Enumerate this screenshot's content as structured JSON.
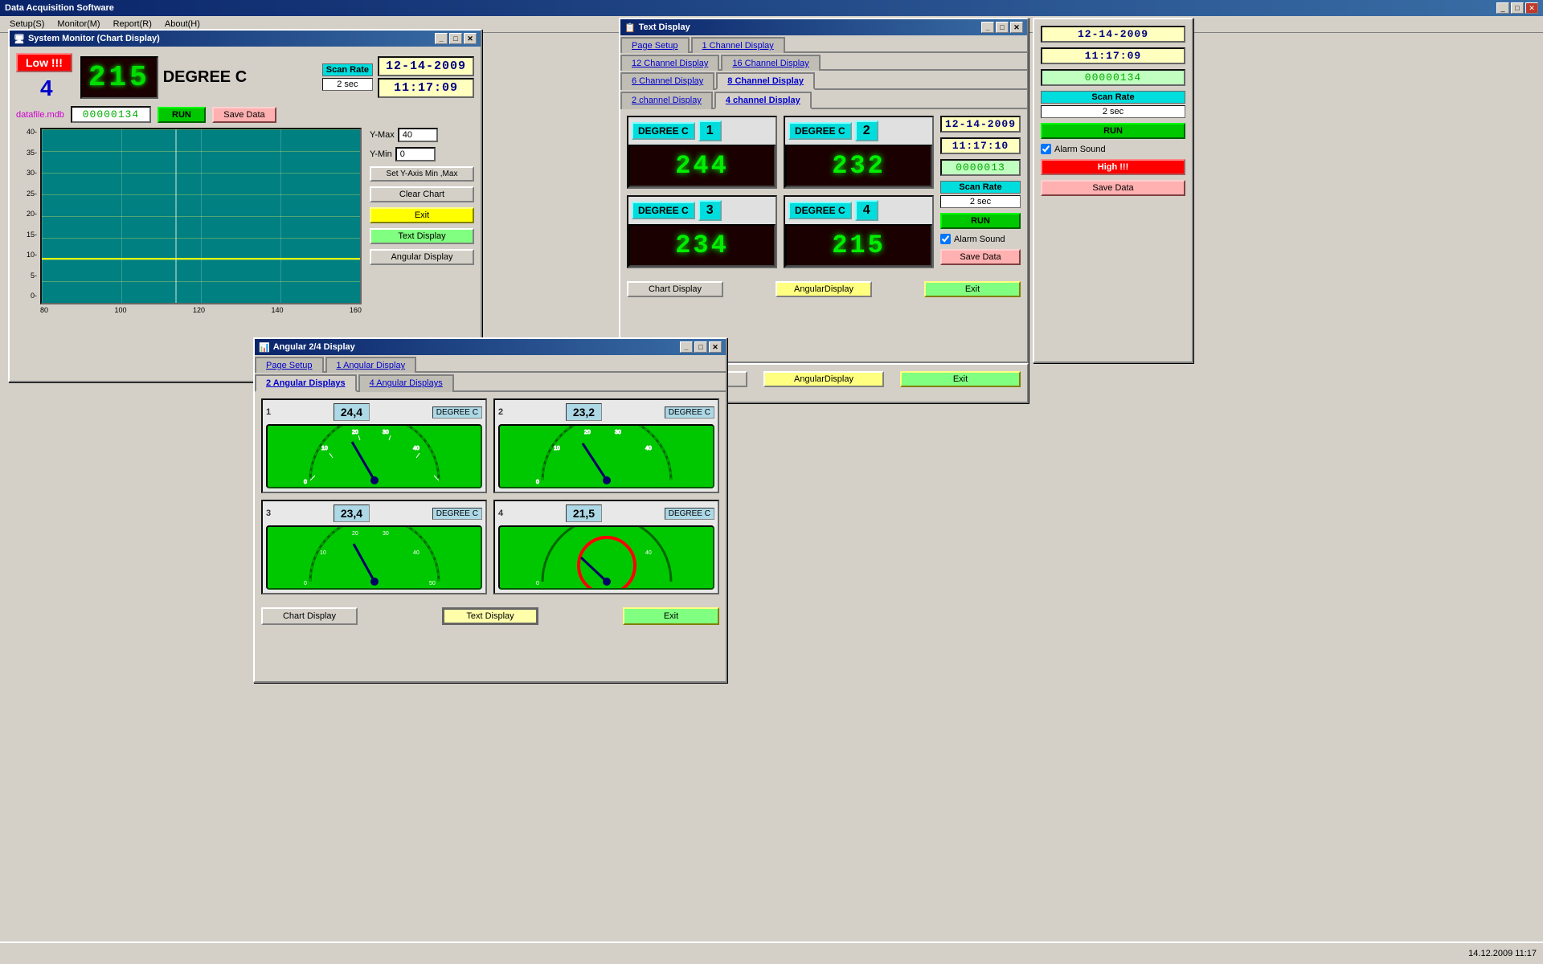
{
  "app": {
    "title": "Data Acquisition Software",
    "menu": [
      "Setup(S)",
      "Monitor(M)",
      "Report(R)",
      "About(H)"
    ]
  },
  "taskbar": {
    "datetime": "14.12.2009",
    "time": "11:17"
  },
  "main_window": {
    "title": "System Monitor (Chart Display)",
    "channel_number": "4",
    "low_badge": "Low !!!",
    "unit": "DEGREE C",
    "seg_value": "215",
    "scan_rate_label": "Scan Rate",
    "scan_rate_value": "2 sec",
    "datetime": "12-14-2009",
    "time": "11:17:09",
    "datafile": "datafile.mdb",
    "record_count": "00000134",
    "run_btn": "RUN",
    "save_data_btn": "Save Data",
    "y_max_label": "Y-Max",
    "y_max_val": "40",
    "y_min_label": "Y-Min",
    "y_min_val": "0",
    "set_axis_btn": "Set Y-Axis Min ,Max",
    "clear_chart_btn": "Clear Chart",
    "exit_btn": "Exit",
    "text_display_btn": "Text Display",
    "angular_display_btn": "Angular Display",
    "chart_x_labels": [
      "80",
      "100",
      "120",
      "140",
      "160"
    ],
    "chart_y_labels": [
      "5",
      "10",
      "15",
      "20",
      "25",
      "30",
      "35",
      "40"
    ]
  },
  "text_display_window": {
    "title": "Text Display",
    "tabs": [
      "Page Setup",
      "1 Channel Display",
      "12 Channel Display",
      "16 Channel Display",
      "6 Channel Display",
      "8 Channel Display",
      "2 channel Display",
      "4 channel Display"
    ],
    "active_tab": "4 channel Display",
    "datetime": "12-14-2009",
    "time": "11:17:10",
    "record_count": "0000013",
    "scan_rate_label": "Scan Rate",
    "scan_rate_value": "2 sec",
    "run_btn": "RUN",
    "alarm_sound_label": "Alarm Sound",
    "save_data_btn": "Save Data",
    "channels": [
      {
        "id": "1",
        "unit": "DEGREE C",
        "value": "244"
      },
      {
        "id": "2",
        "unit": "DEGREE C",
        "value": "232"
      },
      {
        "id": "3",
        "unit": "DEGREE C",
        "value": "234"
      },
      {
        "id": "4",
        "unit": "DEGREE C",
        "value": "215"
      }
    ],
    "bottom_btns": [
      "Chart Display",
      "AngularDisplay",
      "Exit"
    ]
  },
  "angular_window": {
    "title": "Angular 2/4 Display",
    "tabs": [
      "Page Setup",
      "1 Angular Display",
      "2 Angular Displays",
      "4 Angular Displays"
    ],
    "active_tab": "2 Angular Displays",
    "channels": [
      {
        "id": "1",
        "value": "24,4",
        "unit": "DEGREE C"
      },
      {
        "id": "2",
        "value": "23,2",
        "unit": "DEGREE C"
      },
      {
        "id": "3",
        "value": "23,4",
        "unit": "DEGREE C"
      },
      {
        "id": "4",
        "value": "21,5",
        "unit": "DEGREE C"
      }
    ],
    "chart_display_btn": "Chart Display",
    "text_display_btn": "Text Display",
    "exit_btn": "Exit"
  },
  "side_panel": {
    "datetime": "12-14-2009",
    "time": "11:17:09",
    "record_count": "00000134",
    "scan_rate_label": "Scan Rate",
    "scan_rate_value": "2 sec",
    "run_btn": "RUN",
    "alarm_sound_label": "Alarm Sound",
    "high_badge": "High !!!",
    "save_data_btn": "Save Data"
  }
}
